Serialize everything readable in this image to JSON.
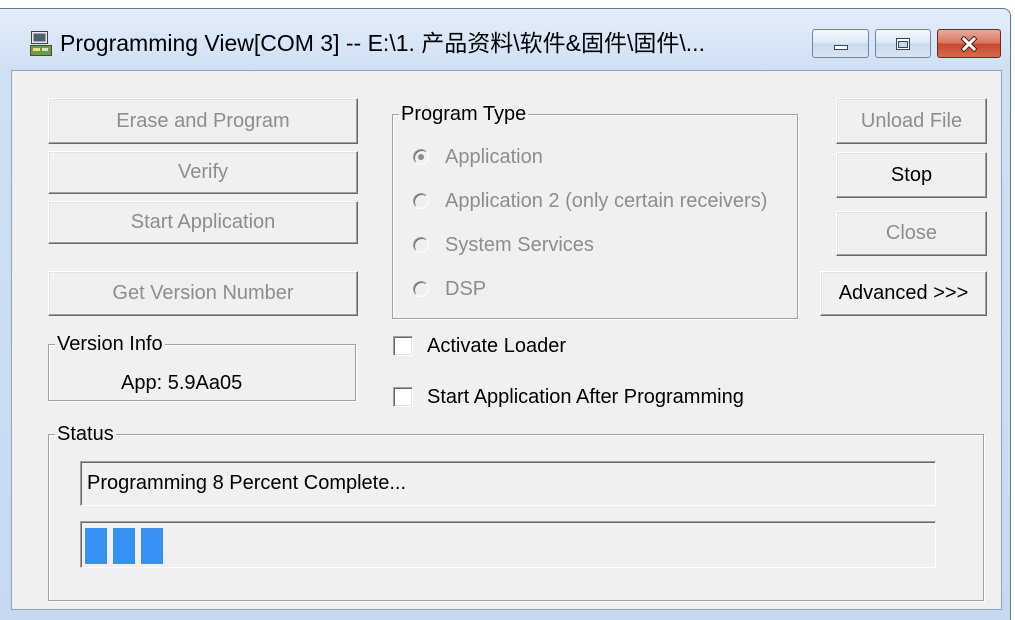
{
  "window": {
    "title": "Programming View[COM 3] -- E:\\1. 产品资料\\软件&固件\\固件\\...",
    "app_icon": "programming-app-icon",
    "minimize_icon": "minimize-icon",
    "maximize_icon": "maximize-icon",
    "close_icon": "close-icon"
  },
  "actions": {
    "erase_and_program": {
      "label": "Erase and Program",
      "enabled": false
    },
    "verify": {
      "label": "Verify",
      "enabled": false
    },
    "start_application": {
      "label": "Start Application",
      "enabled": false
    },
    "get_version_number": {
      "label": "Get Version Number",
      "enabled": false
    }
  },
  "program_type": {
    "label": "Program Type",
    "enabled": false,
    "options": [
      {
        "label": "Application",
        "checked": true
      },
      {
        "label": "Application 2 (only certain receivers)",
        "checked": false
      },
      {
        "label": "System Services",
        "checked": false
      },
      {
        "label": "DSP",
        "checked": false
      }
    ]
  },
  "side_buttons": {
    "unload_file": {
      "label": "Unload File",
      "enabled": false
    },
    "stop": {
      "label": "Stop",
      "enabled": true
    },
    "close": {
      "label": "Close",
      "enabled": false
    },
    "advanced": {
      "label": "Advanced >>>",
      "enabled": true
    }
  },
  "version_info": {
    "label": "Version Info",
    "value": "App: 5.9Aa05"
  },
  "loader_options": {
    "activate_loader": {
      "label": "Activate Loader",
      "checked": false
    },
    "start_after_programming": {
      "label": "Start Application After Programming",
      "checked": false
    }
  },
  "status": {
    "label": "Status",
    "message": "Programming 8 Percent Complete...",
    "progress_percent": 8
  },
  "colors": {
    "dialog_background": "#f0f0f0",
    "progress_fill": "#3790f3",
    "close_button": "#c9462c",
    "disabled_text": "#8d8d8d"
  }
}
